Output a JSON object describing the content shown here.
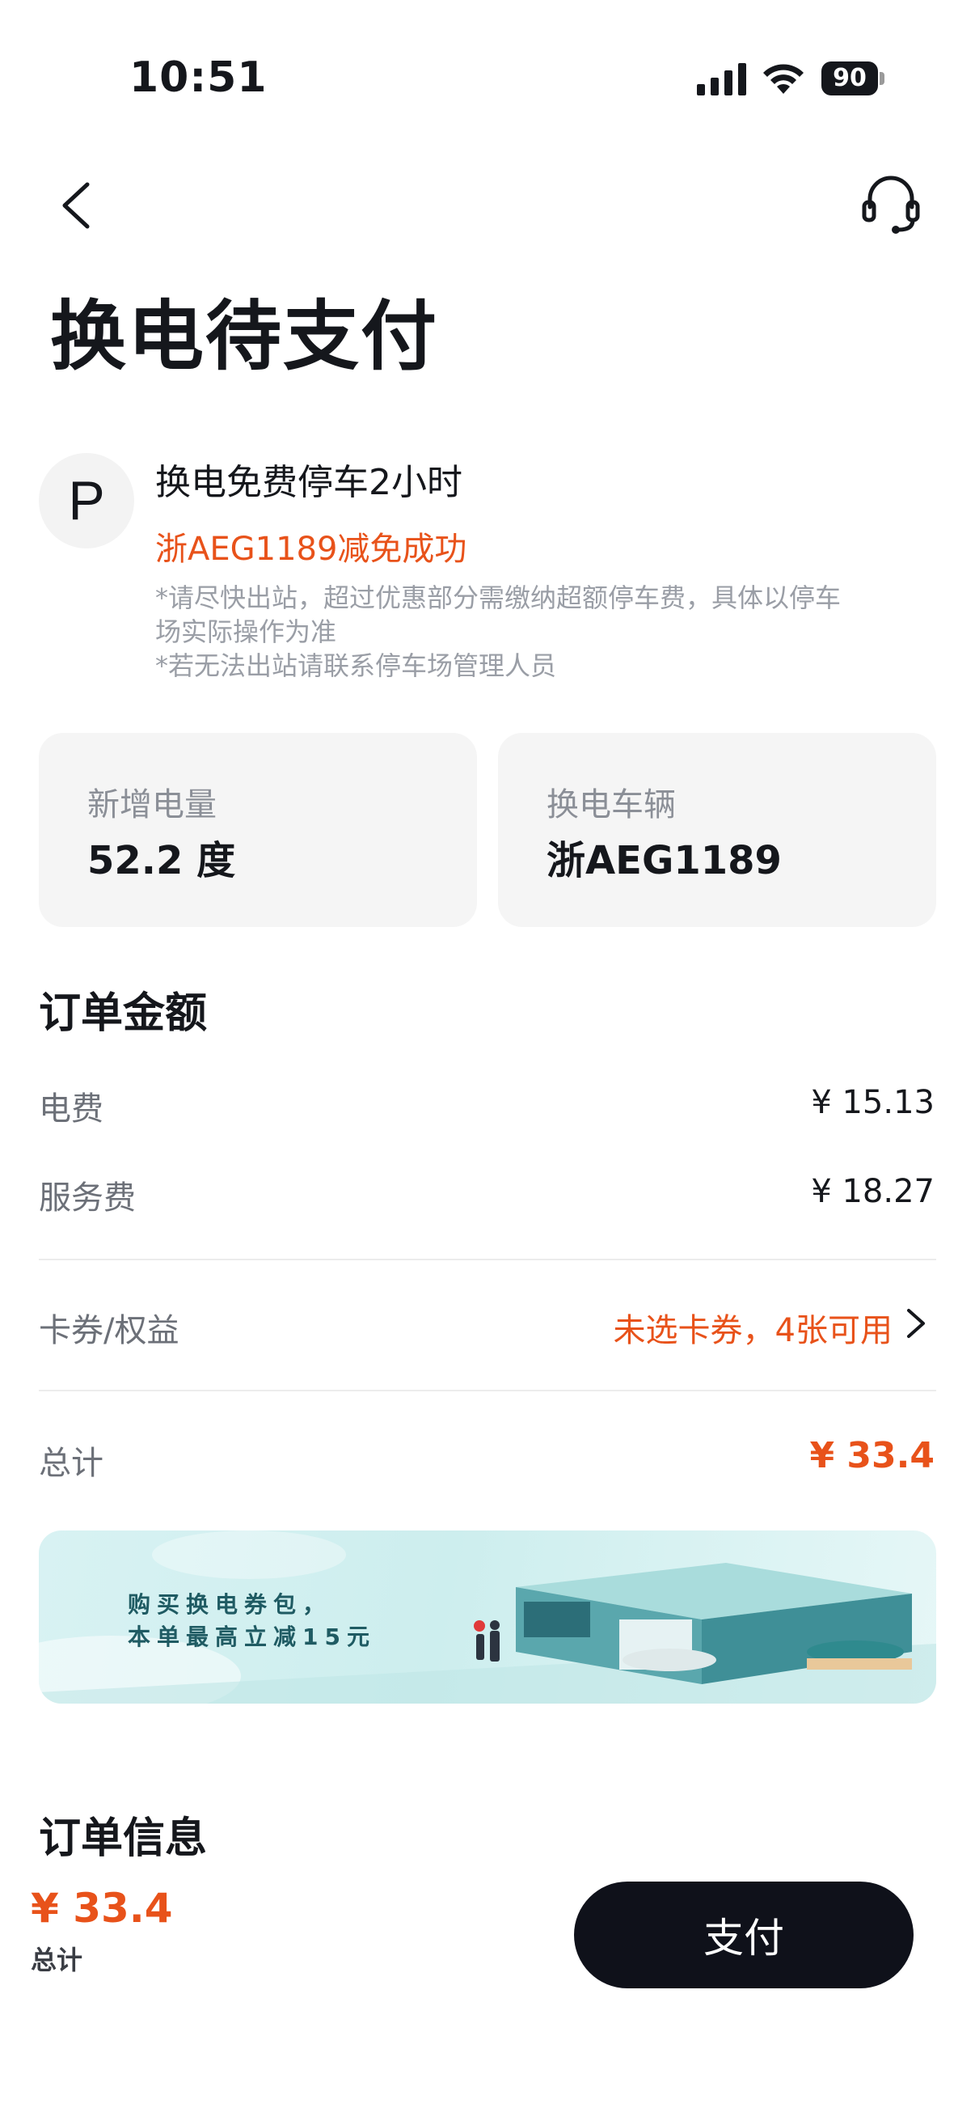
{
  "status_bar": {
    "time": "10:51",
    "battery": "90"
  },
  "header": {
    "title": "换电待支付"
  },
  "parking": {
    "icon_letter": "P",
    "title": "换电免费停车2小时",
    "status": "浙AEG1189减免成功",
    "notes": [
      "*请尽快出站，超过优惠部分需缴纳超额停车费，具体以停车",
      "场实际操作为准",
      "*若无法出站请联系停车场管理人员"
    ]
  },
  "cards": [
    {
      "label": "新增电量",
      "value": "52.2 度"
    },
    {
      "label": "换电车辆",
      "value": "浙AEG1189"
    }
  ],
  "order_amount": {
    "heading": "订单金额",
    "rows": [
      {
        "label": "电费",
        "value": "¥ 15.13"
      },
      {
        "label": "服务费",
        "value": "¥ 18.27"
      }
    ],
    "coupon": {
      "label": "卡券/权益",
      "value": "未选卡券，4张可用"
    },
    "total": {
      "label": "总计",
      "value": "¥ 33.4"
    }
  },
  "banner": {
    "line1": "购买换电券包，",
    "line2": "本单最高立减15元"
  },
  "order_info": {
    "heading": "订单信息"
  },
  "footer": {
    "price": "¥ 33.4",
    "price_label": "总计",
    "pay_label": "支付"
  },
  "colors": {
    "accent": "#e8521a",
    "dark": "#0f111a",
    "card_bg": "#f5f5f5"
  },
  "icons": [
    "signal-icon",
    "wifi-icon",
    "battery-icon",
    "back-arrow-icon",
    "headset-icon",
    "parking-icon",
    "chevron-right-icon"
  ]
}
